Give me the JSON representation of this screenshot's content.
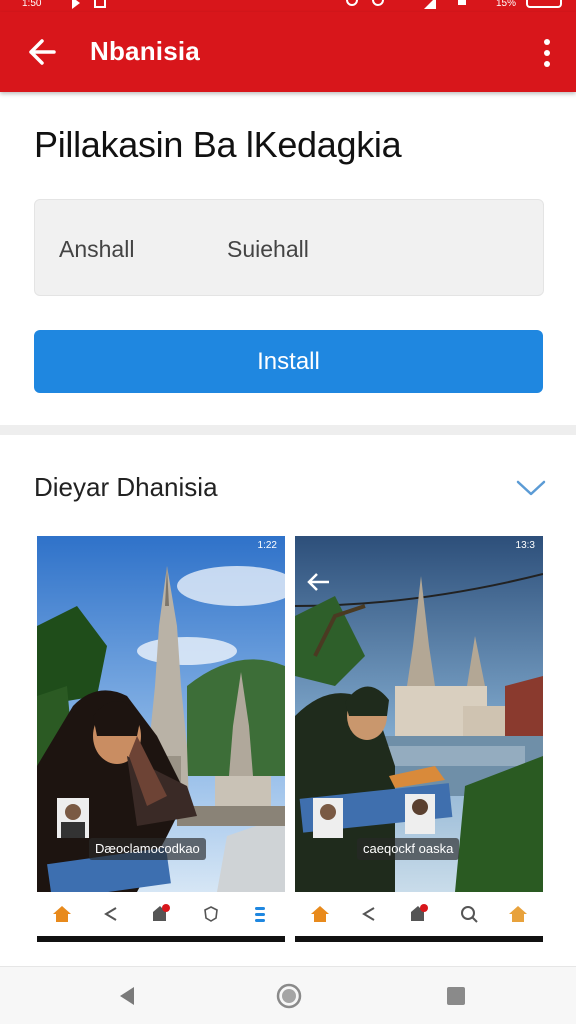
{
  "status_bar": {
    "time": "1:50",
    "battery_percent": "15%"
  },
  "app_bar": {
    "title": "Nbanisia",
    "back_icon": "arrow-left-icon",
    "menu_icon": "more-vertical-icon"
  },
  "app": {
    "name": "Pillakasin Ba lKedagkia",
    "info_left": "Anshall",
    "info_right": "Suiehall",
    "install_label": "Install"
  },
  "screenshots_section": {
    "title": "Dieyar Dhanisia",
    "expand_icon": "chevron-down-icon",
    "items": [
      {
        "status_time": "1:22",
        "caption": "Dæoclamocodkao",
        "nav_icons": [
          "home-icon",
          "share-icon",
          "notification-icon",
          "shield-icon",
          "menu-icon"
        ]
      },
      {
        "status_time": "13:3",
        "caption": "caeqockf oaska",
        "nav_icons": [
          "home-icon",
          "share-icon",
          "notification-icon",
          "search-icon",
          "home-icon"
        ]
      }
    ]
  },
  "nav_bar": {
    "icons": [
      "back-triangle-icon",
      "home-circle-icon",
      "recents-square-icon"
    ]
  },
  "colors": {
    "brand_red": "#d8161b",
    "install_blue": "#1f87e0",
    "accent_orange": "#e88a1c"
  }
}
